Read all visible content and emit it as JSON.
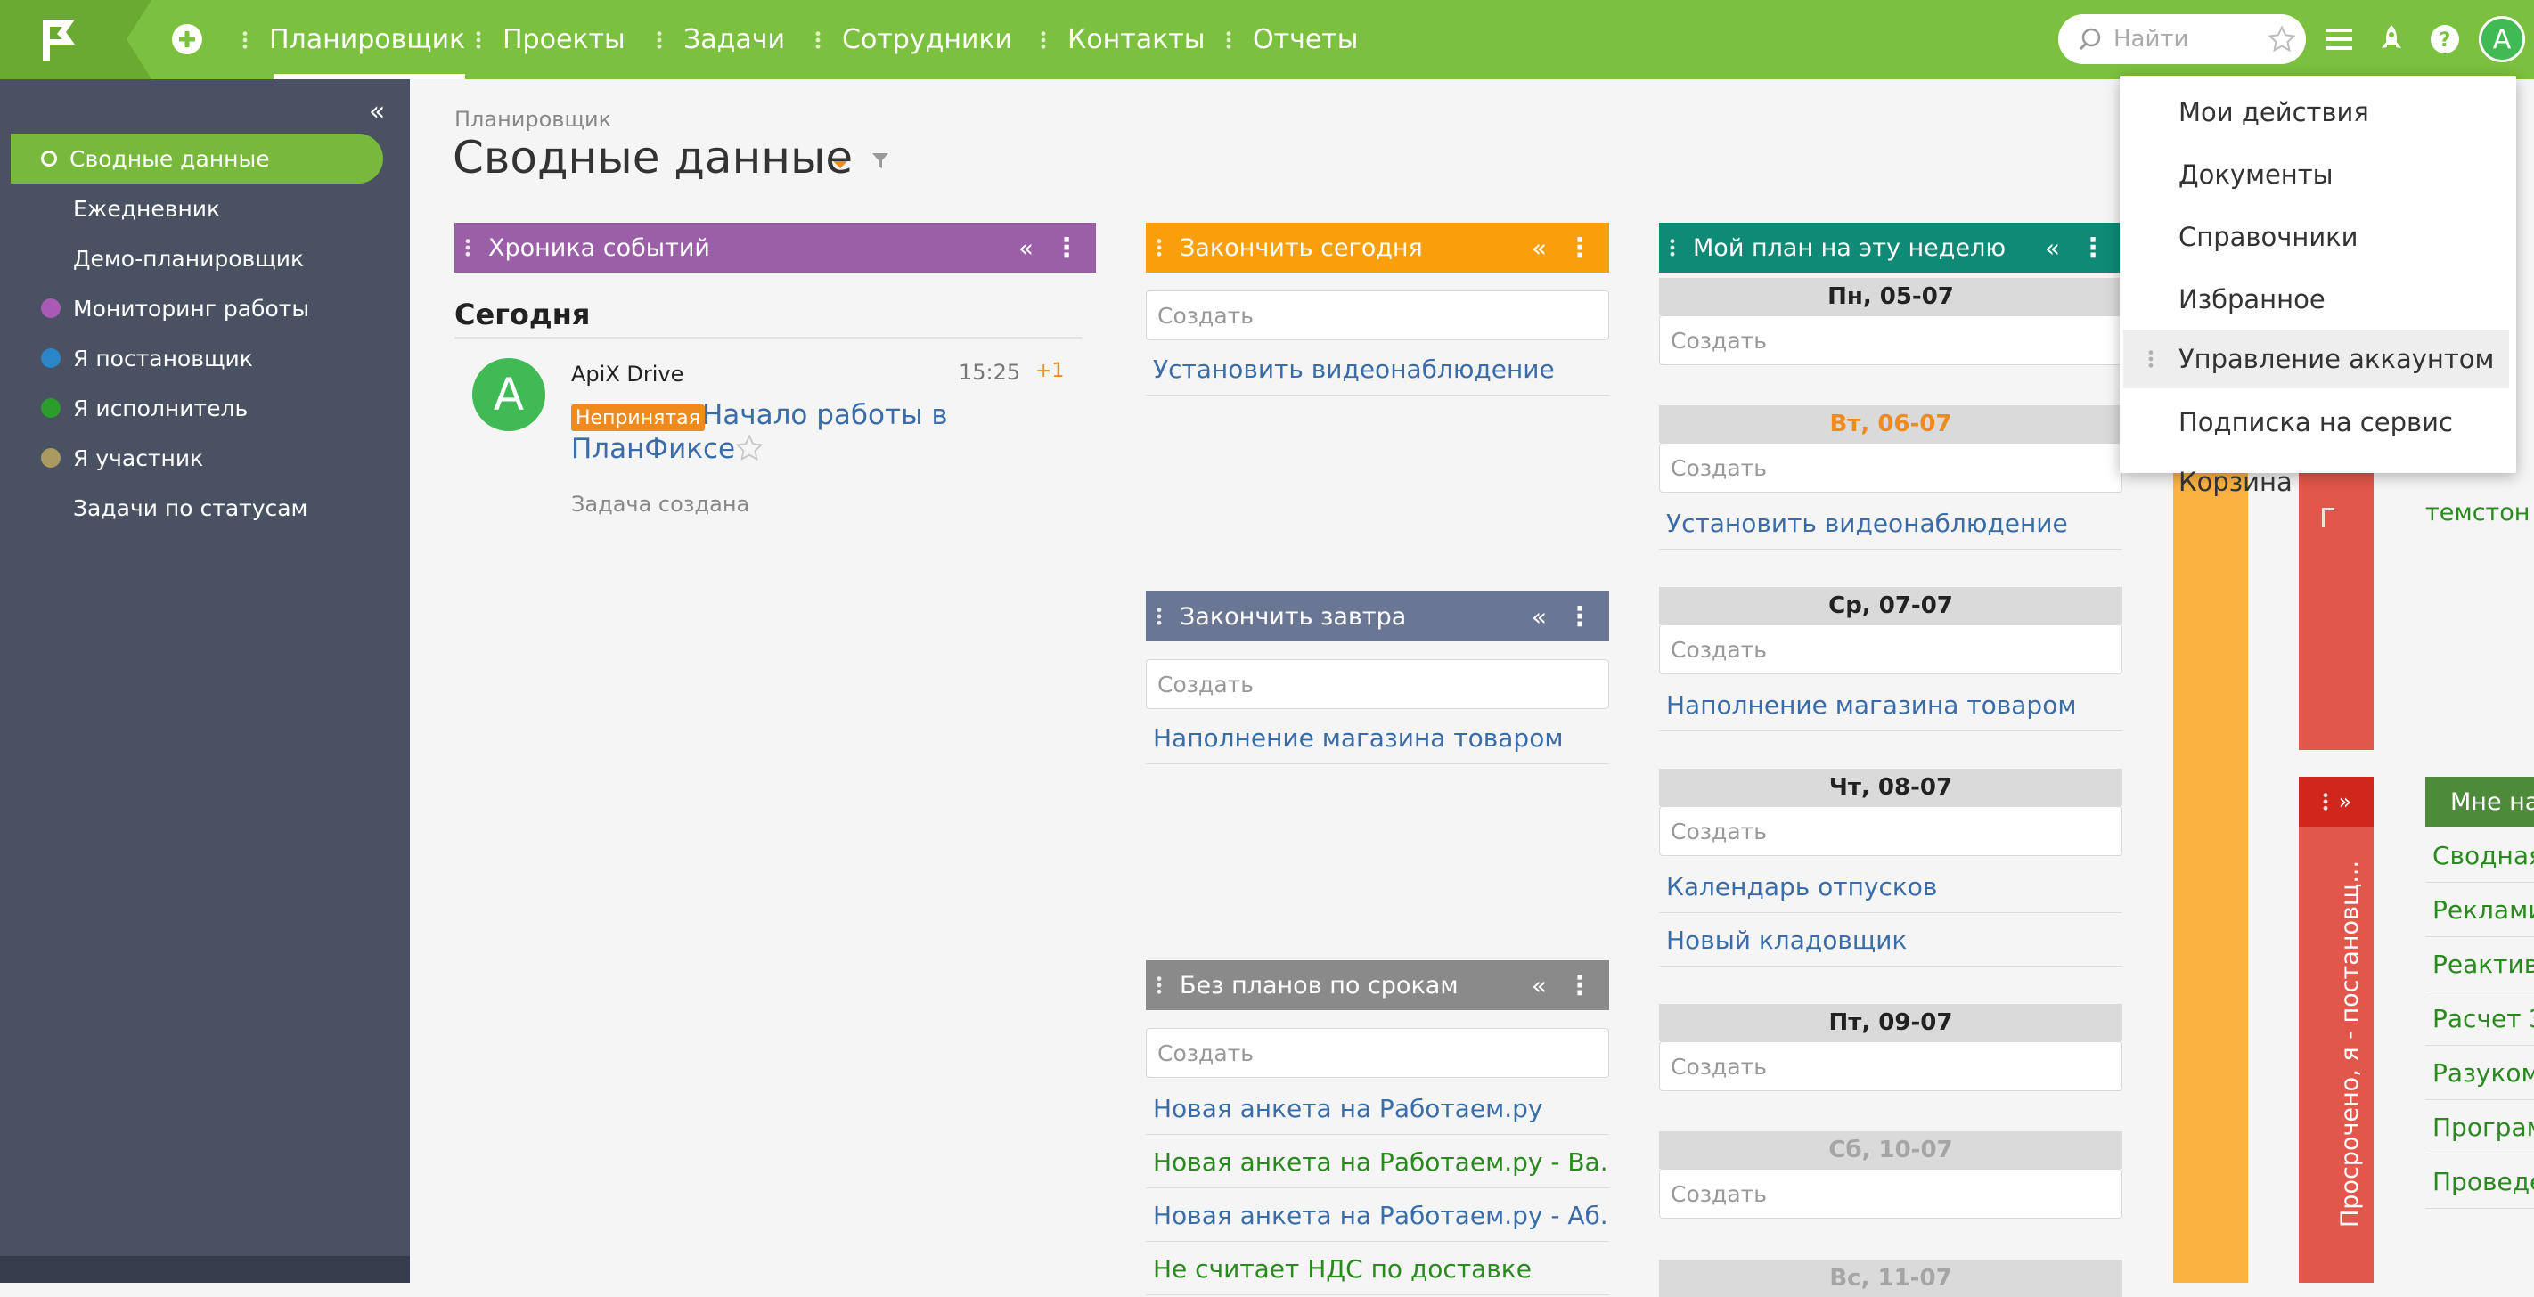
{
  "colors": {
    "topbar": "#7cc03f",
    "sidebar": "#4a5163",
    "sidebar_active": "#78b83c",
    "link_blue": "#3a6da8",
    "link_green": "#2a8a1f",
    "panel_events": "#9b5fa8",
    "panel_today": "#f99f0c",
    "panel_week": "#0e8a76",
    "panel_tomorrow": "#6a7794",
    "panel_noplan": "#8a8a8a",
    "badge_orange": "#f08a1c"
  },
  "topbar": {
    "nav": [
      "Планировщик",
      "Проекты",
      "Задачи",
      "Сотрудники",
      "Контакты",
      "Отчеты"
    ],
    "active_index": 0,
    "search_placeholder": "Найти",
    "avatar_letter": "A",
    "icons": [
      "flag-logo-icon",
      "plus-icon",
      "search-icon",
      "star-icon",
      "menu-icon",
      "rocket-icon",
      "help-icon"
    ]
  },
  "sidebar": {
    "collapse_icon": "«",
    "items": [
      {
        "label": "Сводные данные",
        "marker": "ring"
      },
      {
        "label": "Ежедневник",
        "marker": "none"
      },
      {
        "label": "Демо-планировщик",
        "marker": "none"
      },
      {
        "label": "Мониторинг работы",
        "marker": "#a85bb5"
      },
      {
        "label": "Я постановщик",
        "marker": "#2a86c7"
      },
      {
        "label": "Я исполнитель",
        "marker": "#2a9d2a"
      },
      {
        "label": "Я участник",
        "marker": "#a89a60"
      },
      {
        "label": "Задачи по статусам",
        "marker": "none"
      }
    ]
  },
  "page": {
    "breadcrumb": "Планировщик",
    "title": "Сводные данные"
  },
  "events_panel": {
    "title": "Хроника событий",
    "section": "Сегодня",
    "event": {
      "avatar": "A",
      "author": "ApiX Drive",
      "time": "15:25",
      "counter": "+1",
      "badge": "Непринятая",
      "task_line1": "Начало работы в",
      "task_line2": "ПланФиксе",
      "note": "Задача создана"
    }
  },
  "today_panel": {
    "title": "Закончить сегодня",
    "create_placeholder": "Создать",
    "tasks": [
      "Установить видеонаблюдение"
    ]
  },
  "tomorrow_panel": {
    "title": "Закончить завтра",
    "create_placeholder": "Создать",
    "tasks": [
      "Наполнение магазина товаром"
    ]
  },
  "noplan_panel": {
    "title": "Без планов по срокам",
    "create_placeholder": "Создать",
    "tasks": [
      {
        "label": "Новая анкета на Работаем.ру",
        "color": "blue"
      },
      {
        "label": "Новая анкета на Работаем.ру - Ва...",
        "color": "green"
      },
      {
        "label": "Новая анкета на Работаем.ру - Аб...",
        "color": "blue"
      },
      {
        "label": "Не считает НДС по доставке",
        "color": "green"
      }
    ]
  },
  "week_panel": {
    "title": "Мой план на эту неделю",
    "create_placeholder": "Создать",
    "days": [
      {
        "label": "Пн, 05-07",
        "style": "normal",
        "tasks": []
      },
      {
        "label": "Вт, 06-07",
        "style": "orange",
        "tasks": [
          "Установить видеонаблюдение"
        ]
      },
      {
        "label": "Ср, 07-07",
        "style": "normal",
        "tasks": [
          "Наполнение магазина товаром"
        ]
      },
      {
        "label": "Чт, 08-07",
        "style": "normal",
        "tasks": [
          "Календарь отпусков",
          "Новый кладовщик"
        ]
      },
      {
        "label": "Пт, 09-07",
        "style": "normal",
        "tasks": []
      },
      {
        "label": "Сб, 10-07",
        "style": "gray",
        "tasks": []
      },
      {
        "label": "Вс, 11-07",
        "style": "gray",
        "tasks": []
      }
    ]
  },
  "right_columns": {
    "overdue_label": "Просрочено, я - постановщ...",
    "peek_title": "Мне на",
    "peek_items": [
      "Сводная",
      "Реклами",
      "Реактив",
      "Расчет З",
      "Разуком",
      "Програм",
      "Проведе"
    ],
    "peek_partial": "темстон"
  },
  "dropdown": {
    "items": [
      "Мои действия",
      "Документы",
      "Справочники",
      "Избранное",
      "Управление аккаунтом",
      "Подписка на сервис",
      "Корзина"
    ],
    "hover_index": 4
  }
}
